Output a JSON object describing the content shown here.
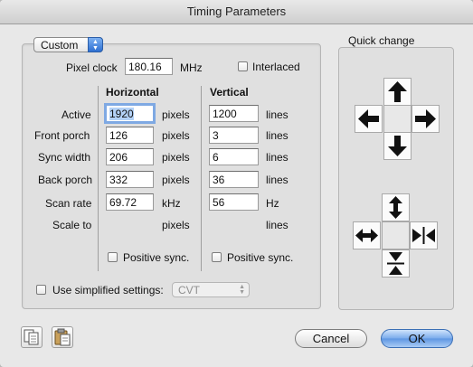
{
  "window": {
    "title": "Timing Parameters"
  },
  "preset": {
    "value": "Custom"
  },
  "pixel_clock": {
    "label": "Pixel clock",
    "value": "180.16",
    "unit": "MHz"
  },
  "interlaced": {
    "label": "Interlaced",
    "checked": false
  },
  "horizontal": {
    "heading": "Horizontal",
    "active": "1920",
    "front_porch": "126",
    "sync_width": "206",
    "back_porch": "332",
    "scan_rate": "69.72",
    "units": {
      "active": "pixels",
      "front_porch": "pixels",
      "sync_width": "pixels",
      "back_porch": "pixels",
      "scan_rate": "kHz",
      "scale_to": "pixels"
    },
    "positive_sync": {
      "label": "Positive sync.",
      "checked": false
    }
  },
  "vertical": {
    "heading": "Vertical",
    "active": "1200",
    "front_porch": "3",
    "sync_width": "6",
    "back_porch": "36",
    "scan_rate": "56",
    "units": {
      "active": "lines",
      "front_porch": "lines",
      "sync_width": "lines",
      "back_porch": "lines",
      "scan_rate": "Hz",
      "scale_to": "lines"
    },
    "positive_sync": {
      "label": "Positive sync.",
      "checked": false
    }
  },
  "row_labels": {
    "active": "Active",
    "front_porch": "Front porch",
    "sync_width": "Sync width",
    "back_porch": "Back porch",
    "scan_rate": "Scan rate",
    "scale_to": "Scale to"
  },
  "simplified": {
    "label": "Use simplified settings:",
    "checked": false,
    "select_value": "CVT"
  },
  "quick_change": {
    "title": "Quick change"
  },
  "buttons": {
    "cancel": "Cancel",
    "ok": "OK"
  },
  "colors": {
    "focus_ring": "#7fa9e3",
    "default_button": "#5e96e2"
  }
}
